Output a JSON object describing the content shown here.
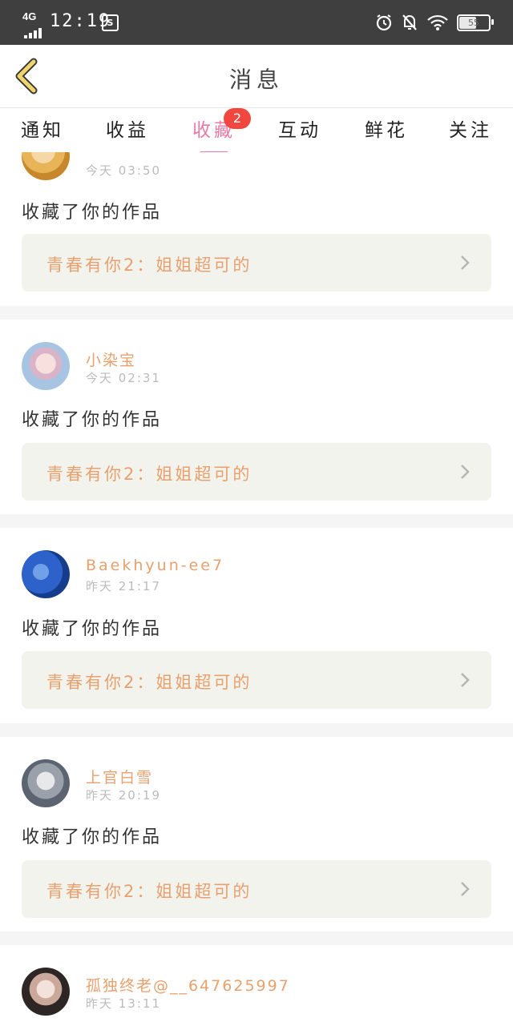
{
  "status_bar": {
    "network": "4G",
    "time": "12:19",
    "sim_icon": "S",
    "battery": "55",
    "battery_level": 0.55,
    "icons": [
      "signal-icon",
      "sim-icon",
      "alarm-icon",
      "bell-off-icon",
      "wifi-icon",
      "battery-icon"
    ]
  },
  "header": {
    "title": "消息",
    "back_icon": "chevron-left-icon"
  },
  "tabs": [
    {
      "label": "通知"
    },
    {
      "label": "收益"
    },
    {
      "label": "收藏",
      "badge": "2",
      "active": true
    },
    {
      "label": "互动"
    },
    {
      "label": "鲜花"
    },
    {
      "label": "关注"
    }
  ],
  "notifications": [
    {
      "user": "",
      "time": "今天 03:50",
      "action": "收藏了你的作品",
      "work_title": "青春有你2：姐姐超可的"
    },
    {
      "user": "小染宝",
      "time": "今天 02:31",
      "action": "收藏了你的作品",
      "work_title": "青春有你2：姐姐超可的"
    },
    {
      "user": "Baekhyun-ee7",
      "time": "昨天 21:17",
      "action": "收藏了你的作品",
      "work_title": "青春有你2：姐姐超可的"
    },
    {
      "user": "上官白雪",
      "time": "昨天 20:19",
      "action": "收藏了你的作品",
      "work_title": "青春有你2：姐姐超可的"
    },
    {
      "user": "孤独终老@__647625997",
      "time": "昨天 13:11",
      "action": "",
      "work_title": ""
    }
  ],
  "colors": {
    "accent_pink": "#e97aa6",
    "badge_red": "#f2473f",
    "username_orange": "#e8a06e",
    "work_bg": "#f3f3ed",
    "back_arrow": "#f0d66a",
    "status_bar_bg": "#3f3f3f"
  }
}
